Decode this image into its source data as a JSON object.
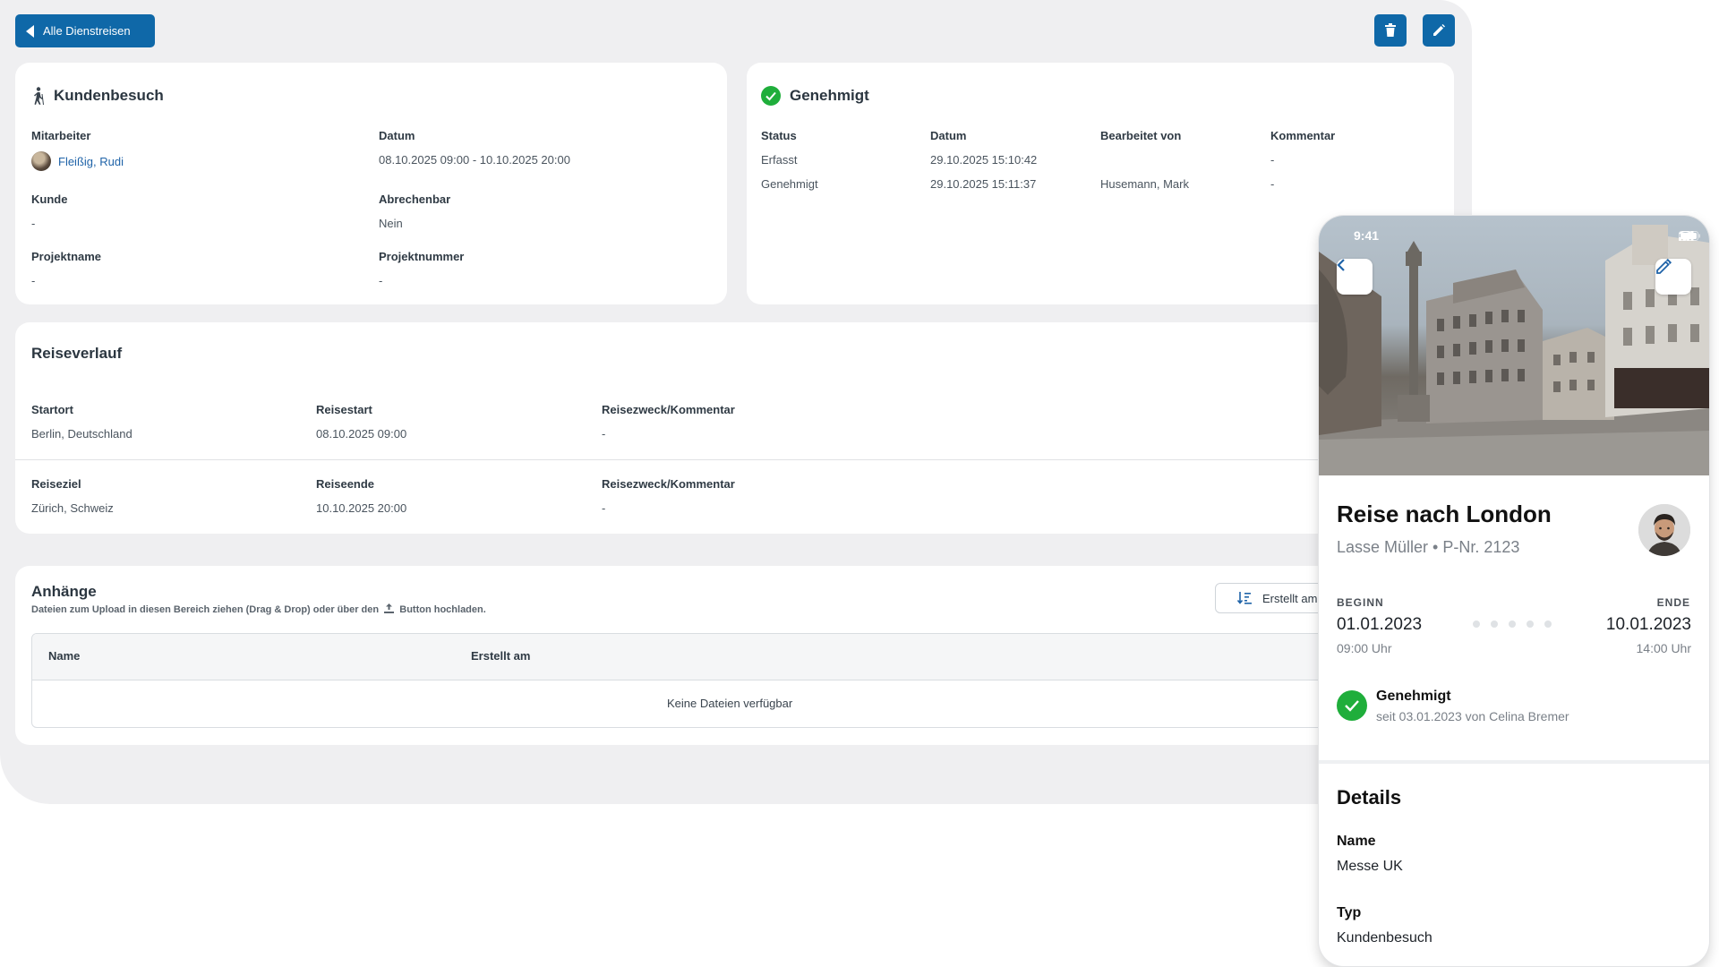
{
  "toolbar": {
    "back_label": "Alle Dienstreisen",
    "delete_icon": "trash-icon",
    "edit_icon": "pencil-icon",
    "accent": "#0f68a8"
  },
  "trip": {
    "title": "Kundenbesuch",
    "fields": {
      "mitarbeiter_label": "Mitarbeiter",
      "mitarbeiter_value": "Fleißig, Rudi",
      "datum_label": "Datum",
      "datum_value": "08.10.2025 09:00 - 10.10.2025 20:00",
      "kunde_label": "Kunde",
      "kunde_value": "-",
      "abrechenbar_label": "Abrechenbar",
      "abrechenbar_value": "Nein",
      "projektname_label": "Projektname",
      "projektname_value": "-",
      "projektnummer_label": "Projektnummer",
      "projektnummer_value": "-"
    }
  },
  "approval": {
    "title": "Genehmigt",
    "status_color": "#1fae3b",
    "headers": [
      "Status",
      "Datum",
      "Bearbeitet von",
      "Kommentar"
    ],
    "rows": [
      [
        "Erfasst",
        "29.10.2025 15:10:42",
        "",
        "-"
      ],
      [
        "Genehmigt",
        "29.10.2025 15:11:37",
        "Husemann, Mark",
        "-"
      ]
    ]
  },
  "itinerary": {
    "title": "Reiseverlauf",
    "rows": [
      {
        "l1": "Startort",
        "v1": "Berlin, Deutschland",
        "l2": "Reisestart",
        "v2": "08.10.2025 09:00",
        "l3": "Reisezweck/Kommentar",
        "v3": "-"
      },
      {
        "l1": "Reiseziel",
        "v1": "Zürich, Schweiz",
        "l2": "Reiseende",
        "v2": "10.10.2025 20:00",
        "l3": "Reisezweck/Kommentar",
        "v3": "-"
      }
    ]
  },
  "attachments": {
    "title": "Anhänge",
    "hint_before": "Dateien zum Upload in diesen Bereich ziehen (Drag & Drop) oder über den",
    "hint_after": "Button hochladen.",
    "sort_label": "Erstellt am",
    "col_name": "Name",
    "col_created": "Erstellt am",
    "empty": "Keine Dateien verfügbar"
  },
  "phone": {
    "status_time": "9:41",
    "title": "Reise nach London",
    "subtitle": "Lasse Müller • P-Nr. 2123",
    "begin_caption": "BEGINN",
    "end_caption": "ENDE",
    "begin_date": "01.01.2023",
    "begin_time": "09:00 Uhr",
    "end_date": "10.01.2023",
    "end_time": "14:00 Uhr",
    "status_title": "Genehmigt",
    "status_sub": "seit 03.01.2023 von Celina Bremer",
    "details_title": "Details",
    "name_label": "Name",
    "name_value": "Messe UK",
    "type_label": "Typ",
    "type_value": "Kundenbesuch"
  }
}
